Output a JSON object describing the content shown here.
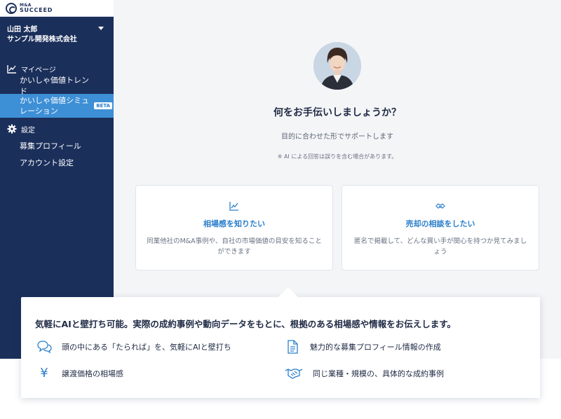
{
  "brand": {
    "line1": "M&A",
    "line2": "SUCCEED"
  },
  "user": {
    "name": "山田 太郎",
    "company": "サンプル開発株式会社"
  },
  "sidebar": {
    "mypage_label": "マイページ",
    "items_mypage": [
      {
        "label": "かいしゃ価値トレンド"
      },
      {
        "label": "かいしゃ価値シミュレーション",
        "badge": "BETA"
      }
    ],
    "settings_label": "設定",
    "items_settings": [
      {
        "label": "募集プロフィール"
      },
      {
        "label": "アカウント設定"
      }
    ]
  },
  "main": {
    "question": "何をお手伝いしましょうか？",
    "subtitle": "目的に合わせた形でサポートします",
    "note": "※ AI による回答は誤りを含む場合があります。",
    "cards": [
      {
        "title": "相場感を知りたい",
        "desc": "同業他社のM&A事例や、自社の市場価値の目安を知ることができます",
        "icon": "chart-line-icon"
      },
      {
        "title": "売却の相談をしたい",
        "desc": "匿名で掲載して、どんな買い手が関心を持つか見てみましょう",
        "icon": "handshake-icon"
      }
    ]
  },
  "popup": {
    "headline": "気軽にAIと壁打ち可能。実際の成約事例や動向データをもとに、根拠のある相場感や情報をお伝えします。",
    "features": [
      {
        "label": "頭の中にある「たられば」を、気軽にAIと壁打ち",
        "icon": "chat-bubbles-icon"
      },
      {
        "label": "魅力的な募集プロフィール情報の作成",
        "icon": "document-icon"
      },
      {
        "label": "譲渡価格の相場感",
        "icon": "yen-icon",
        "glyph": "¥"
      },
      {
        "label": "同じ業種・規模の、具体的な成約事例",
        "icon": "handshake-icon"
      }
    ]
  },
  "colors": {
    "sidebar": "#1b2f5b",
    "accent": "#3d8fd6",
    "link": "#2b7fcb",
    "background": "#f4f5f7"
  }
}
